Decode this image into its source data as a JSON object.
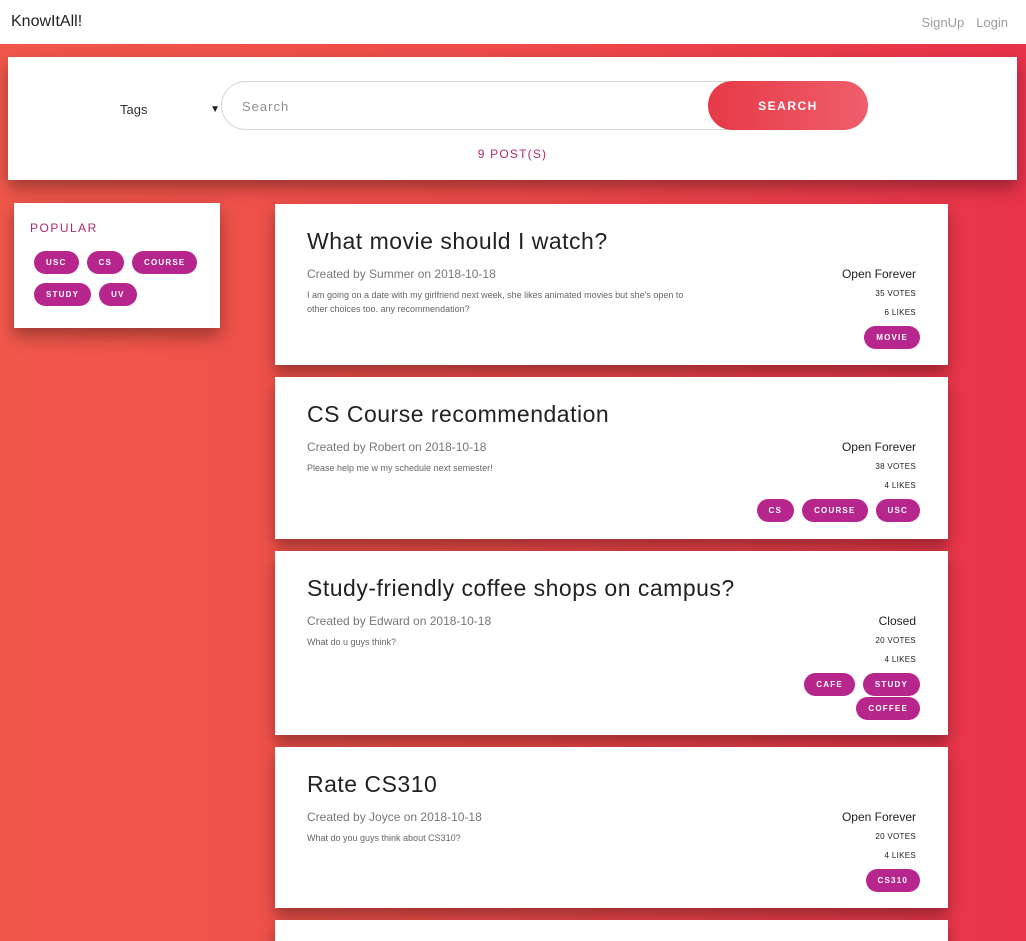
{
  "navbar": {
    "brand": "KnowItAll!",
    "signup": "SignUp",
    "login": "Login"
  },
  "search": {
    "tags_label": "Tags",
    "placeholder": "Search",
    "value": "",
    "button_label": "SEARCH",
    "post_count": "9 POST(S)"
  },
  "popular": {
    "title": "POPULAR",
    "tags": [
      "USC",
      "CS",
      "COURSE",
      "STUDY",
      "UV"
    ]
  },
  "posts": [
    {
      "title": "What movie should I watch?",
      "meta": "Created by Summer on 2018-10-18",
      "description": "I am going on a date with my girlfriend next week, she likes animated movies but she's open to other choices too. any recommendation?",
      "status": "Open Forever",
      "votes": "35 VOTES",
      "likes": "6 LIKES",
      "tags": [
        "MOVIE"
      ]
    },
    {
      "title": "CS Course recommendation",
      "meta": "Created by Robert on 2018-10-18",
      "description": "Please help me w my schedule next semester!",
      "status": "Open Forever",
      "votes": "38 VOTES",
      "likes": "4 LIKES",
      "tags": [
        "CS",
        "COURSE",
        "USC"
      ]
    },
    {
      "title": "Study-friendly coffee shops on campus?",
      "meta": "Created by Edward on 2018-10-18",
      "description": "What do u guys think?",
      "status": "Closed",
      "votes": "20 VOTES",
      "likes": "4 LIKES",
      "tags": [
        "CAFE",
        "STUDY",
        "COFFEE"
      ]
    },
    {
      "title": "Rate CS310",
      "meta": "Created by Joyce on 2018-10-18",
      "description": "What do you guys think about CS310?",
      "status": "Open Forever",
      "votes": "20 VOTES",
      "likes": "4 LIKES",
      "tags": [
        "CS310"
      ]
    }
  ]
}
